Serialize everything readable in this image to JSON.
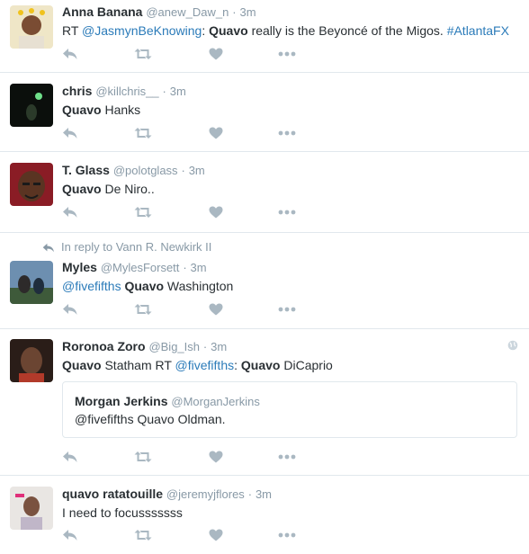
{
  "tweets": [
    {
      "name": "Anna Banana",
      "handle": "@anew_Daw_n",
      "dot": "·",
      "time": "3m",
      "text": {
        "prefix": "RT ",
        "mention": "@JasmynBeKnowing",
        "colon": ": ",
        "bold": "Quavo",
        "rest": " really is the Beyoncé of the Migos. ",
        "hashtag": "#AtlantaFX"
      }
    },
    {
      "name": "chris",
      "handle": "@killchris__",
      "dot": "·",
      "time": "3m",
      "text": {
        "bold": "Quavo",
        "rest": " Hanks"
      }
    },
    {
      "name": "T. Glass",
      "handle": "@polotglass",
      "dot": "·",
      "time": "3m",
      "text": {
        "bold": "Quavo",
        "rest": " De Niro.."
      }
    },
    {
      "reply_context": "In reply to Vann R. Newkirk II",
      "name": "Myles",
      "handle": "@MylesForsett",
      "dot": "·",
      "time": "3m",
      "text": {
        "mention": "@fivefifths",
        "bold": "Quavo",
        "rest": " Washington"
      }
    },
    {
      "name": "Roronoa Zoro",
      "handle": "@Big_Ish",
      "dot": "·",
      "time": "3m",
      "text": {
        "bold": "Quavo",
        "rest": " Statham RT ",
        "mention": "@fivefifths",
        "colon": ": ",
        "bold2": "Quavo",
        "rest2": " DiCaprio"
      },
      "quote": {
        "name": "Morgan Jerkins",
        "handle": "@MorganJerkins",
        "text": "@fivefifths Quavo Oldman."
      }
    },
    {
      "name": "quavo ratatouille",
      "handle": "@jeremyjflores",
      "dot": "·",
      "time": "3m",
      "text": {
        "rest": "I need to focusssssss"
      }
    }
  ],
  "icons": {
    "reply": "reply-arrow-icon",
    "retweet": "retweet-icon",
    "like": "heart-icon",
    "more": "more-dots-icon",
    "globe": "globe-icon"
  },
  "colors": {
    "icon": "#aab8c2",
    "link": "#2b7bb9",
    "meta": "#8899a6",
    "text": "#292f33",
    "border": "#e1e8ed"
  }
}
